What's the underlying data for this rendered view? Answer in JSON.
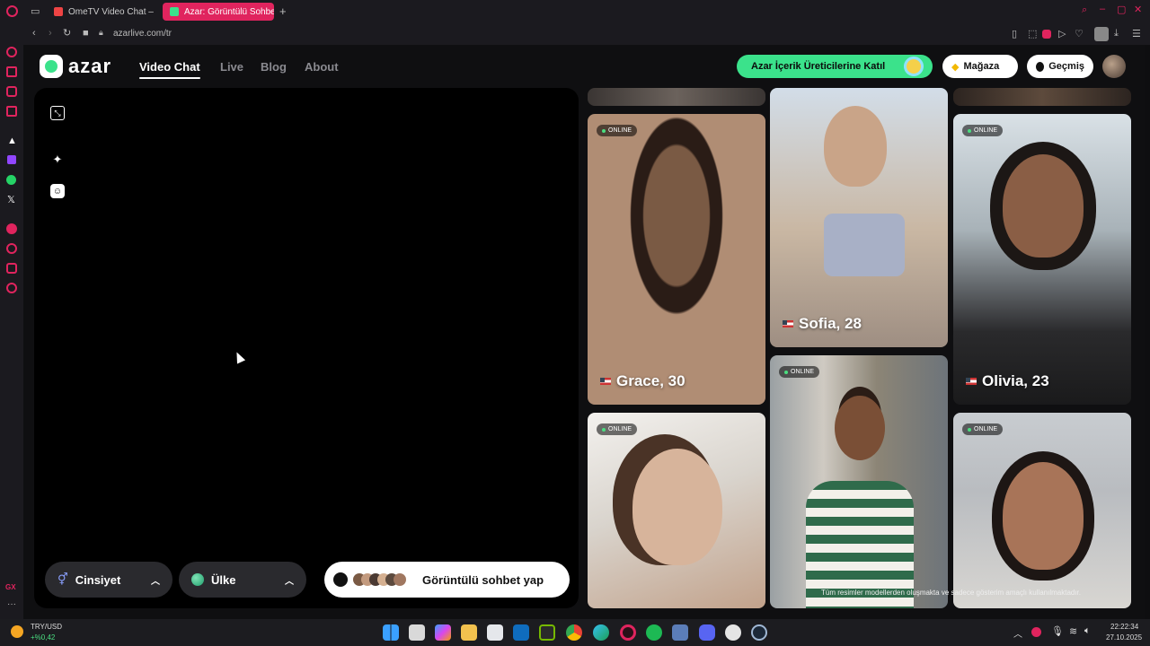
{
  "browser": {
    "tabs": [
      {
        "label": "OmeTV Video Chat –",
        "active": false
      },
      {
        "label": "Azar: Görüntülü Sohbet, Y",
        "active": true
      }
    ],
    "new_tab": "+",
    "url": "azarlive.com/tr"
  },
  "header": {
    "logo": "azar",
    "nav": [
      "Video Chat",
      "Live",
      "Blog",
      "About"
    ],
    "creator_cta": "Azar İçerik Üreticilerine Katıl",
    "shop": "Mağaza",
    "history": "Geçmiş"
  },
  "video_panel": {
    "icons": [
      "minimize-icon",
      "sparkle-icon",
      "face-icon"
    ]
  },
  "controls": {
    "gender": "Cinsiyet",
    "country": "Ülke",
    "start": "Görüntülü sohbet yap"
  },
  "profiles": [
    {
      "name": "Grace, 30",
      "status": "ONLINE",
      "tone": "#7a5a44"
    },
    {
      "name": "Sofia, 28",
      "status": "",
      "tone": "#c9b7a3"
    },
    {
      "name": "Olivia, 23",
      "status": "ONLINE",
      "tone": "#4b3a33"
    },
    {
      "name": "",
      "status": "ONLINE",
      "tone": "#d9d4cd"
    },
    {
      "name": "",
      "status": "ONLINE",
      "tone": "#8c8576"
    },
    {
      "name": "",
      "status": "ONLINE",
      "tone": "#b9bcc0"
    }
  ],
  "disclaimer": "Tüm resimler modellerden oluşmakta ve sadece gösterim amaçlı kullanılmaktadır.",
  "taskbar": {
    "ticker_pair": "TRY/USD",
    "ticker_change": "+%0,42",
    "time": "22:22:34",
    "date": "27.10.2025"
  }
}
